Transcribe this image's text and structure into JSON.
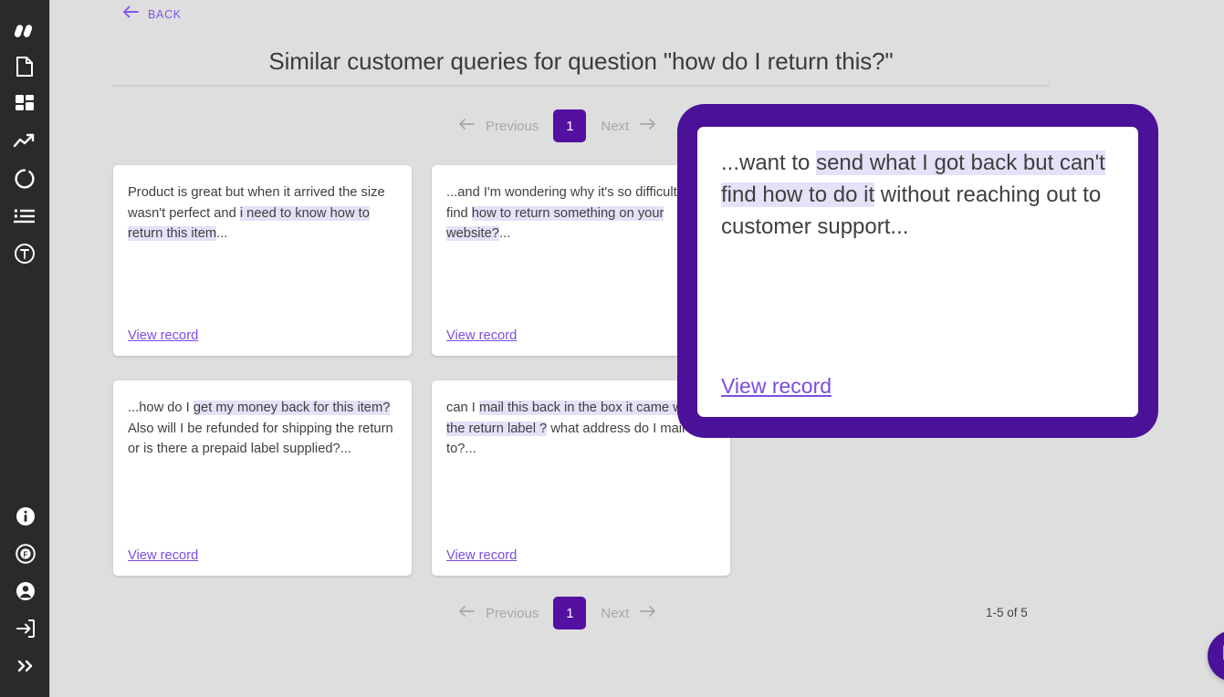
{
  "sidebar": {
    "top_items": [
      {
        "name": "logo-icon",
        "label": "Logo"
      },
      {
        "name": "document-icon",
        "label": "Documents"
      },
      {
        "name": "dashboard-grid-icon",
        "label": "Dashboard"
      },
      {
        "name": "trending-up-icon",
        "label": "Trends"
      },
      {
        "name": "donut-chart-icon",
        "label": "Reports"
      },
      {
        "name": "list-icon",
        "label": "Lists"
      },
      {
        "name": "text-circle-icon",
        "label": "Text analytics"
      }
    ],
    "bottom_items": [
      {
        "name": "info-icon",
        "label": "Info"
      },
      {
        "name": "feedback-circle-icon",
        "label": "Feedback"
      },
      {
        "name": "account-icon",
        "label": "Account"
      },
      {
        "name": "logout-icon",
        "label": "Log out"
      },
      {
        "name": "expand-chevrons-icon",
        "label": "Expand menu"
      }
    ]
  },
  "header": {
    "back_label": "BACK",
    "title": "Similar customer queries for question \"how do I return this?\""
  },
  "pagination": {
    "previous_label": "Previous",
    "next_label": "Next",
    "current_page": "1",
    "range_label": "1-5 of 5"
  },
  "cards": [
    {
      "view_label": "View record",
      "segments": [
        {
          "text": "Product is great but when it arrived the size wasn't perfect and ",
          "highlight": false
        },
        {
          "text": "i need to know how to return this item",
          "highlight": true
        },
        {
          "text": "...",
          "highlight": false
        }
      ]
    },
    {
      "view_label": "View record",
      "segments": [
        {
          "text": "...and I'm wondering why it's so difficult to find ",
          "highlight": false
        },
        {
          "text": "how to return something on your website?",
          "highlight": true
        },
        {
          "text": "...",
          "highlight": false
        }
      ]
    },
    {
      "view_label": "View record",
      "segments": [
        {
          "text": "...how do I ",
          "highlight": false
        },
        {
          "text": "get my money back for this item?",
          "highlight": true
        },
        {
          "text": " Also will I be refunded for shipping the return or is there a prepaid label supplied?...",
          "highlight": false
        }
      ]
    },
    {
      "view_label": "View record",
      "segments": [
        {
          "text": "can I ",
          "highlight": false
        },
        {
          "text": "mail this back in the box it came with the return label ?",
          "highlight": true
        },
        {
          "text": " what address do I mail it to?...",
          "highlight": false
        }
      ]
    }
  ],
  "popup_card": {
    "view_label": "View record",
    "segments": [
      {
        "text": "...want to ",
        "highlight": false
      },
      {
        "text": "send what I got back but can't find how to do it",
        "highlight": true
      },
      {
        "text": " without reaching out to customer support...",
        "highlight": false
      }
    ]
  },
  "chat": {
    "icon": "chat-bubble-smile-icon"
  },
  "colors": {
    "page_background": "#dedede",
    "sidebar_background": "#2b2a28",
    "accent_purple": "#5410a0",
    "popup_border": "#4b1199",
    "link_purple": "#7a4de0",
    "back_link": "#8157e8",
    "highlight": "#e6e0f8",
    "card_background": "#ffffff",
    "muted_text": "#a8a8a8"
  }
}
